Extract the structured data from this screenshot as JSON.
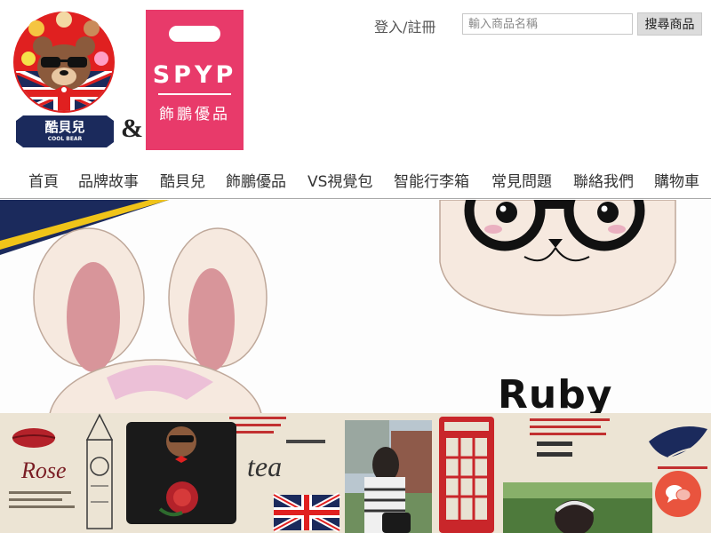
{
  "header": {
    "logos": {
      "coolbear_label": "酷貝兒",
      "coolbear_sub": "COOL BEAR",
      "ampersand": "&",
      "spyp_name": "SPYP",
      "spyp_sub": "飾鵬優品"
    },
    "login_label": "登入/註冊",
    "search": {
      "placeholder": "輸入商品名稱",
      "value": "",
      "button_label": "搜尋商品"
    }
  },
  "nav": {
    "items": [
      {
        "label": "首頁"
      },
      {
        "label": "品牌故事"
      },
      {
        "label": "酷貝兒"
      },
      {
        "label": "飾鵬優品"
      },
      {
        "label": "VS視覺包"
      },
      {
        "label": "智能行李箱"
      },
      {
        "label": "常見問題"
      },
      {
        "label": "聯絡我們"
      },
      {
        "label": "購物車"
      }
    ]
  },
  "hero": {
    "ruby_label": "Ruby"
  },
  "collage": {
    "word_rose": "Rose",
    "word_tea": "tea"
  },
  "colors": {
    "brand_pink": "#e83a6a",
    "brand_red": "#e02020",
    "navy": "#1b2a5c",
    "chat_orange": "#e9543e",
    "collage_bg": "#ece4d4"
  },
  "icons": [
    "chat-bubble-icon",
    "coolbear-logo",
    "spyp-logo"
  ]
}
